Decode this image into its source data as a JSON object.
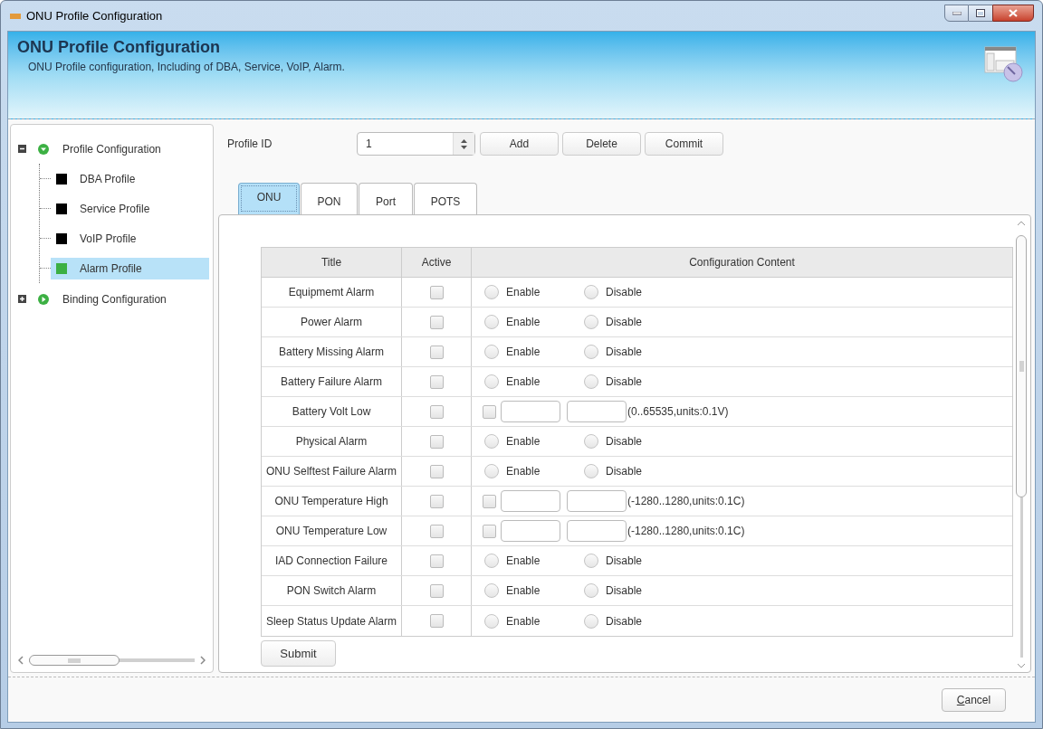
{
  "window": {
    "title": "ONU Profile Configuration"
  },
  "header": {
    "title": "ONU Profile Configuration",
    "subtitle": "ONU Profile configuration, Including of DBA, Service, VoIP, Alarm."
  },
  "tree": [
    {
      "label": "Profile Configuration",
      "expanded": true,
      "selected": false,
      "children": [
        {
          "label": "DBA Profile",
          "selected": false
        },
        {
          "label": "Service Profile",
          "selected": false
        },
        {
          "label": "VoIP Profile",
          "selected": false
        },
        {
          "label": "Alarm Profile",
          "selected": true
        }
      ]
    },
    {
      "label": "Binding Configuration",
      "expanded": false,
      "selected": false
    }
  ],
  "toolbar": {
    "profile_id_label": "Profile ID",
    "profile_id": "1",
    "buttons": [
      "Add",
      "Delete",
      "Commit"
    ]
  },
  "tabs": [
    {
      "label": "ONU",
      "selected": true
    },
    {
      "label": "PON",
      "selected": false
    },
    {
      "label": "Port",
      "selected": false
    },
    {
      "label": "POTS",
      "selected": false
    }
  ],
  "table": {
    "columns": [
      "Title",
      "Active",
      "Configuration Content"
    ],
    "rows": [
      {
        "kind": "radio",
        "title": "Equipmemt Alarm",
        "active": false,
        "options": [
          {
            "label": "Enable",
            "selected": false
          },
          {
            "label": "Disable",
            "selected": false
          }
        ]
      },
      {
        "kind": "radio",
        "title": "Power Alarm",
        "active": false,
        "options": [
          {
            "label": "Enable",
            "selected": false
          },
          {
            "label": "Disable",
            "selected": false
          }
        ]
      },
      {
        "kind": "radio",
        "title": "Battery Missing Alarm",
        "active": false,
        "options": [
          {
            "label": "Enable",
            "selected": false
          },
          {
            "label": "Disable",
            "selected": false
          }
        ]
      },
      {
        "kind": "radio",
        "title": "Battery Failure Alarm",
        "active": false,
        "options": [
          {
            "label": "Enable",
            "selected": false
          },
          {
            "label": "Disable",
            "selected": false
          }
        ]
      },
      {
        "kind": "range",
        "title": "Battery Volt Low",
        "active": false,
        "checked": false,
        "hint": "(0..65535,units:0.1V)"
      },
      {
        "kind": "radio",
        "title": "Physical Alarm",
        "active": false,
        "options": [
          {
            "label": "Enable",
            "selected": false
          },
          {
            "label": "Disable",
            "selected": false
          }
        ]
      },
      {
        "kind": "radio",
        "title": "ONU Selftest Failure Alarm",
        "active": false,
        "options": [
          {
            "label": "Enable",
            "selected": false
          },
          {
            "label": "Disable",
            "selected": false
          }
        ]
      },
      {
        "kind": "range",
        "title": "ONU Temperature High",
        "active": false,
        "checked": false,
        "hint": "(-1280..1280,units:0.1C)"
      },
      {
        "kind": "range",
        "title": "ONU Temperature Low",
        "active": false,
        "checked": false,
        "hint": "(-1280..1280,units:0.1C)"
      },
      {
        "kind": "radio",
        "title": "IAD Connection Failure",
        "active": false,
        "options": [
          {
            "label": "Enable",
            "selected": false
          },
          {
            "label": "Disable",
            "selected": false
          }
        ]
      },
      {
        "kind": "radio",
        "title": "PON Switch Alarm",
        "active": false,
        "options": [
          {
            "label": "Enable",
            "selected": false
          },
          {
            "label": "Disable",
            "selected": false
          }
        ]
      },
      {
        "kind": "radio",
        "title": "Sleep Status Update Alarm",
        "active": false,
        "options": [
          {
            "label": "Enable",
            "selected": false
          },
          {
            "label": "Disable",
            "selected": false
          }
        ]
      }
    ]
  },
  "submit": "Submit",
  "footer": {
    "cancel": "Cancel"
  }
}
